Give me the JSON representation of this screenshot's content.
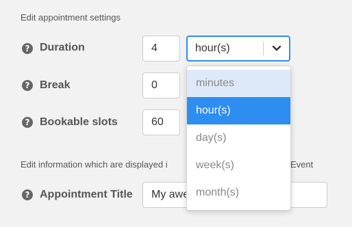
{
  "settings_label": "Edit appointment settings",
  "help_glyph": "?",
  "duration": {
    "label": "Duration",
    "value": "4"
  },
  "unit_select": {
    "value": "hour(s)"
  },
  "break": {
    "label": "Break",
    "value": "0"
  },
  "slots": {
    "label": "Bookable slots",
    "value": "60"
  },
  "info_label_left": "Edit information which are displayed i",
  "info_label_right": "Event",
  "appointment_title": {
    "label": "Appointment Title",
    "value": "My awe"
  },
  "dropdown": {
    "options": [
      "minutes",
      "hour(s)",
      "day(s)",
      "week(s)",
      "month(s)"
    ],
    "selected": "hour(s)",
    "hovered": "minutes"
  },
  "colors": {
    "accent": "#2e8df0",
    "hover": "#dde9f9"
  }
}
